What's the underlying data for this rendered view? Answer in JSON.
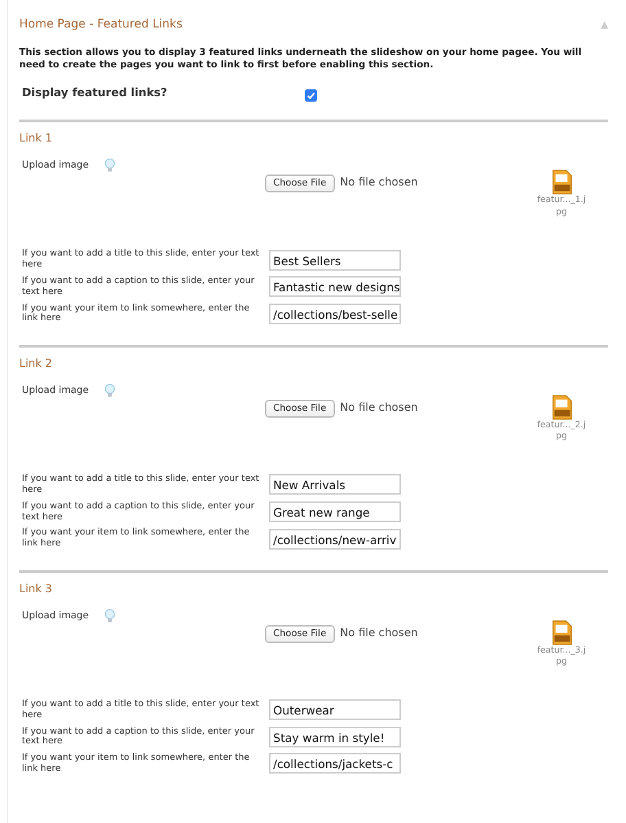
{
  "section": {
    "title": "Home Page - Featured Links",
    "collapse_icon": "▲",
    "expanded": true,
    "description": "This section allows you to display 3 featured links underneath the slideshow on your home pagee. You will need to create the pages you want to link to first before enabling this section.",
    "toggle": {
      "label": "Display featured links?",
      "checked": true
    }
  },
  "links": [
    {
      "heading": "Link 1",
      "upload_label": "Upload image",
      "button": "Choose File",
      "file_status": "No file chosen",
      "thumbnail_name": "featur..._1.jpg",
      "fields": [
        {
          "label": "If you want to add a title to this slide, enter your text here",
          "value": "Best Sellers"
        },
        {
          "label": "If you want to add a caption to this slide, enter your text here",
          "value": "Fantastic new designs"
        },
        {
          "label": "If you want your item to link somewhere, enter the link here",
          "value": "/collections/best-selle"
        }
      ]
    },
    {
      "heading": "Link 2",
      "upload_label": "Upload image",
      "button": "Choose File",
      "file_status": "No file chosen",
      "thumbnail_name": "featur..._2.jpg",
      "fields": [
        {
          "label": "If you want to add a title to this slide, enter your text here",
          "value": "New Arrivals"
        },
        {
          "label": "If you want to add a caption to this slide, enter your text here",
          "value": "Great new range"
        },
        {
          "label": "If you want your item to link somewhere, enter the link here",
          "value": "/collections/new-arriv"
        }
      ]
    },
    {
      "heading": "Link 3",
      "upload_label": "Upload image",
      "button": "Choose File",
      "file_status": "No file chosen",
      "thumbnail_name": "featur..._3.jpg",
      "fields": [
        {
          "label": "If you want to add a title to this slide, enter your text here",
          "value": "Outerwear"
        },
        {
          "label": "If you want to add a caption to this slide, enter your text here",
          "value": "Stay warm in style!"
        },
        {
          "label": "If you want your item to link somewhere, enter the link here",
          "value": "/collections/jackets-c"
        }
      ]
    }
  ]
}
